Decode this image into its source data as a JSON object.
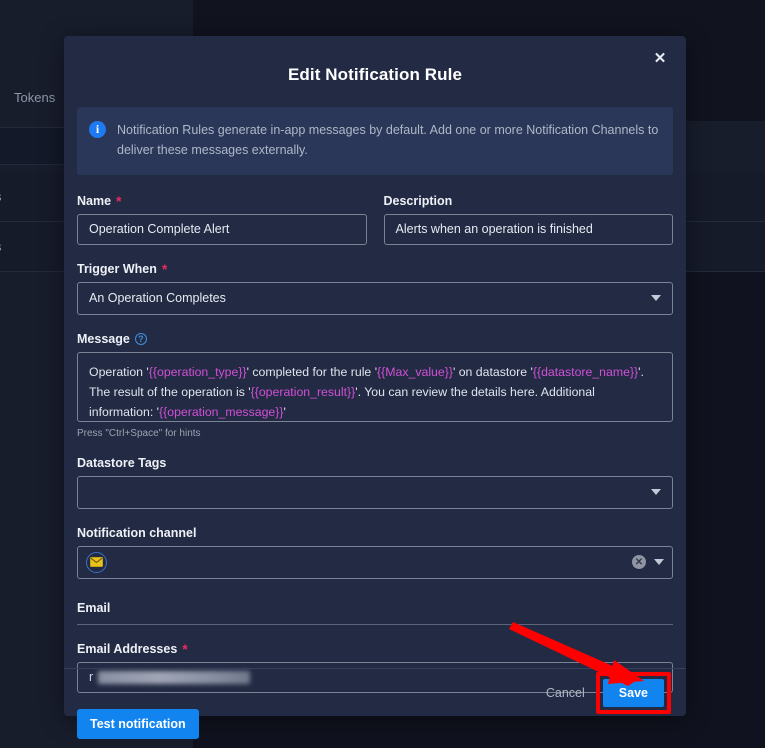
{
  "background": {
    "nav": {
      "tokens_label": "Tokens"
    },
    "rows": [
      {
        "text": "mpletes"
      },
      {
        "text": "mpletes"
      }
    ]
  },
  "modal": {
    "title": "Edit Notification Rule",
    "close_icon": "close-icon",
    "info_banner": {
      "icon": "info-icon",
      "text": "Notification Rules generate in-app messages by default. Add one or more Notification Channels to deliver these messages externally."
    },
    "fields": {
      "name": {
        "label": "Name",
        "required_marker": "*",
        "value": "Operation Complete Alert"
      },
      "description": {
        "label": "Description",
        "value": "Alerts when an operation is finished"
      },
      "trigger_when": {
        "label": "Trigger When",
        "required_marker": "*",
        "value": "An Operation Completes"
      },
      "message": {
        "label": "Message",
        "help_icon": "question-mark-icon",
        "segments": [
          {
            "text": "Operation '",
            "type": "plain"
          },
          {
            "text": "{{operation_type}}",
            "type": "var"
          },
          {
            "text": "' completed for the rule '",
            "type": "plain"
          },
          {
            "text": "{{Max_value}}",
            "type": "var"
          },
          {
            "text": "' on datastore '",
            "type": "plain"
          },
          {
            "text": "{{datastore_name}}",
            "type": "var"
          },
          {
            "text": "'. The result of the operation is '",
            "type": "plain"
          },
          {
            "text": "{{operation_result}}",
            "type": "var"
          },
          {
            "text": "'. You can review the details here. Additional information: '",
            "type": "plain"
          },
          {
            "text": "{{operation_message}}",
            "type": "var"
          },
          {
            "text": "'",
            "type": "plain"
          }
        ],
        "hint": "Press \"Ctrl+Space\" for hints"
      },
      "datastore_tags": {
        "label": "Datastore Tags",
        "value": ""
      },
      "notification_channel": {
        "label": "Notification channel",
        "chip_icon": "email-envelope-icon",
        "clear_icon": "clear-icon",
        "dropdown_icon": "chevron-down-icon"
      },
      "email_section": {
        "heading": "Email",
        "addresses_label": "Email Addresses",
        "required_marker": "*",
        "value_redacted": true,
        "value_prefix": "r"
      }
    },
    "buttons": {
      "test_notification": "Test notification",
      "cancel": "Cancel",
      "save": "Save"
    }
  },
  "annotation": {
    "highlight_color": "#ff0000",
    "arrow_target": "save-button"
  }
}
